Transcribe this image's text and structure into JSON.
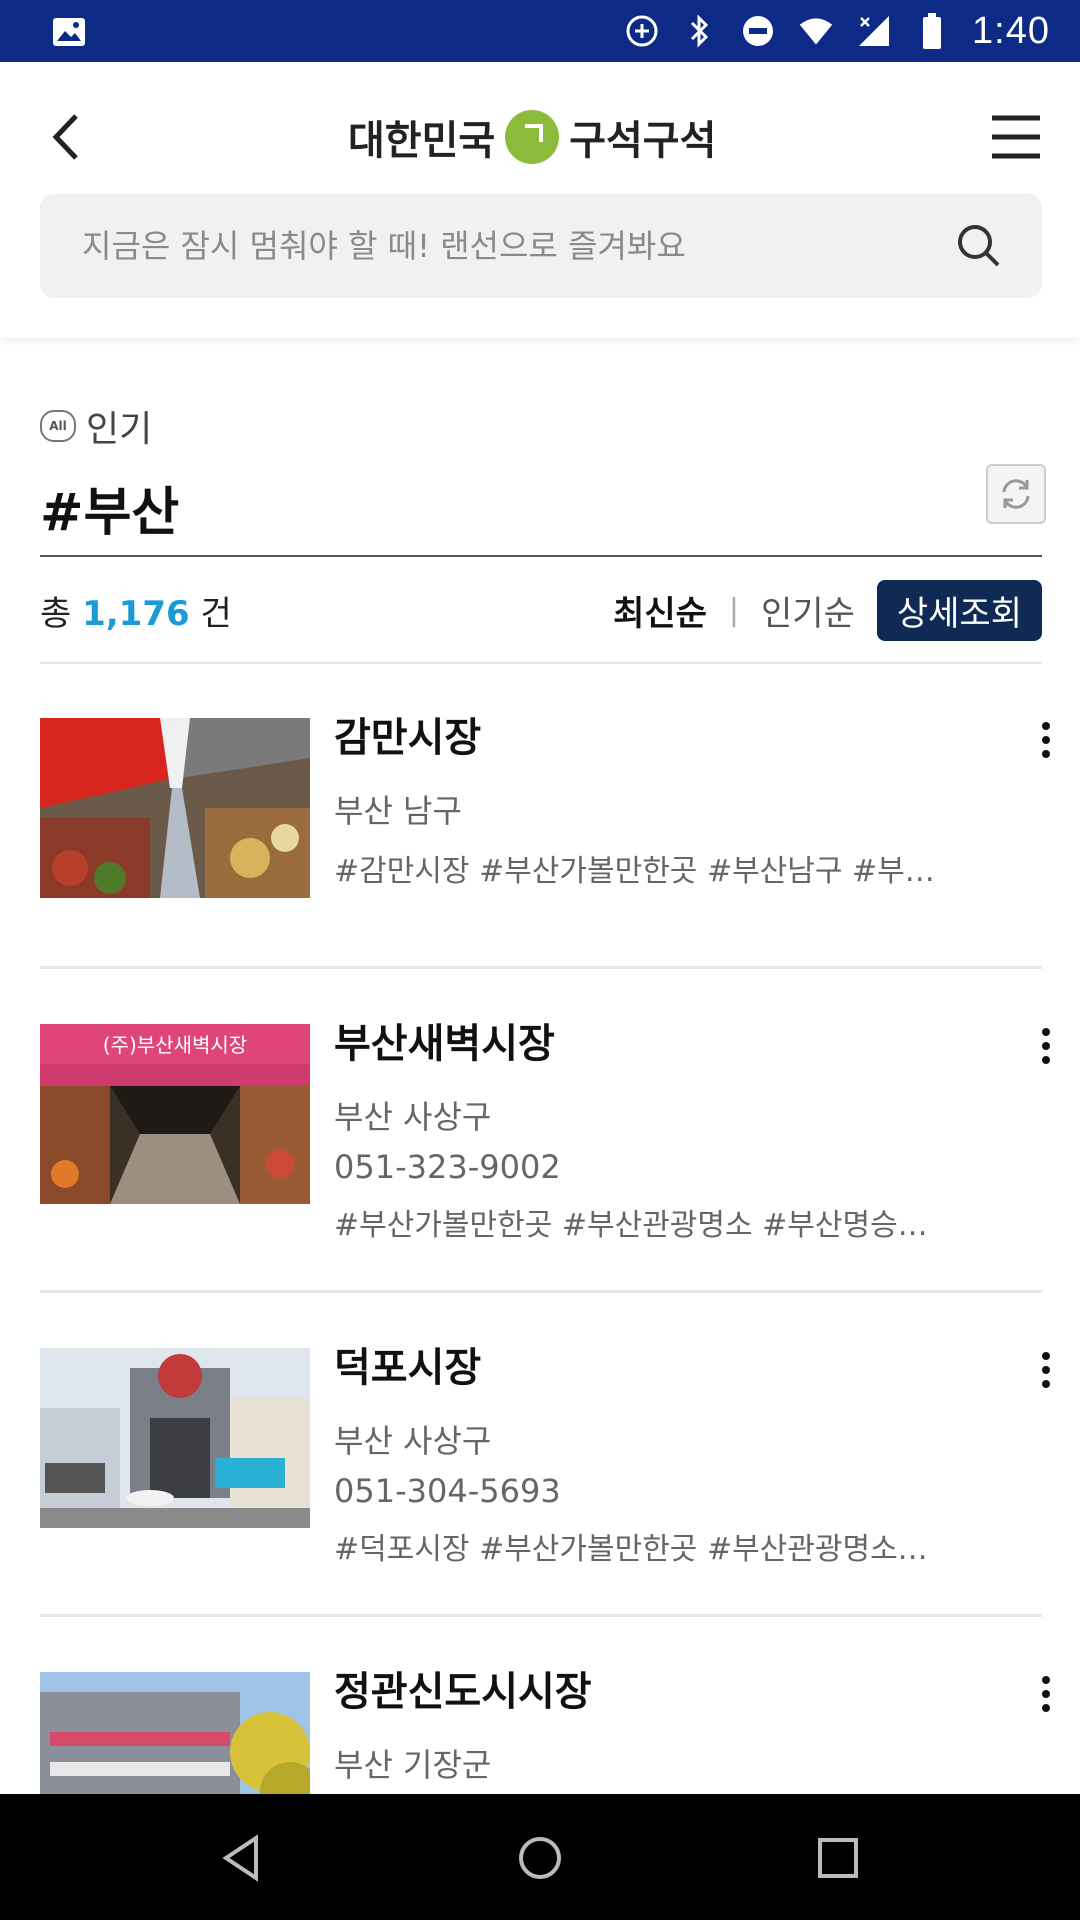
{
  "status_bar": {
    "time": "1:40",
    "icons": [
      "image-icon",
      "data-saver-icon",
      "bluetooth-icon",
      "do-not-disturb-icon",
      "wifi-icon",
      "signal-icon",
      "battery-icon"
    ]
  },
  "header": {
    "logo_left": "대한민국",
    "logo_right": "구석구석",
    "search_placeholder": "지금은 잠시 멈춰야 할 때! 랜선으로 즐겨봐요",
    "icons": [
      "back-arrow-icon",
      "menu-icon",
      "search-icon"
    ]
  },
  "section": {
    "badge": "All",
    "category_label": "인기",
    "tag": "#부산"
  },
  "summary": {
    "prefix": "총",
    "count": "1,176",
    "suffix": "건"
  },
  "sort": {
    "latest": "최신순",
    "separator": "|",
    "popular": "인기순",
    "detail": "상세조회"
  },
  "items": [
    {
      "name": "감만시장",
      "address": "부산 남구",
      "phone": "",
      "tags": "#감만시장 #부산가볼만한곳 #부산남구 #부…"
    },
    {
      "name": "부산새벽시장",
      "address": "부산 사상구",
      "phone": "051-323-9002",
      "tags": "#부산가볼만한곳 #부산관광명소 #부산명승…",
      "sign_text": "(주)부산새벽시장"
    },
    {
      "name": "덕포시장",
      "address": "부산 사상구",
      "phone": "051-304-5693",
      "tags": "#덕포시장 #부산가볼만한곳 #부산관광명소…"
    },
    {
      "name": "정관신도시시장",
      "address": "부산 기장군",
      "phone": "",
      "tags": ""
    }
  ],
  "nav": {
    "icons": [
      "back-triangle-icon",
      "home-circle-icon",
      "recents-square-icon"
    ]
  }
}
